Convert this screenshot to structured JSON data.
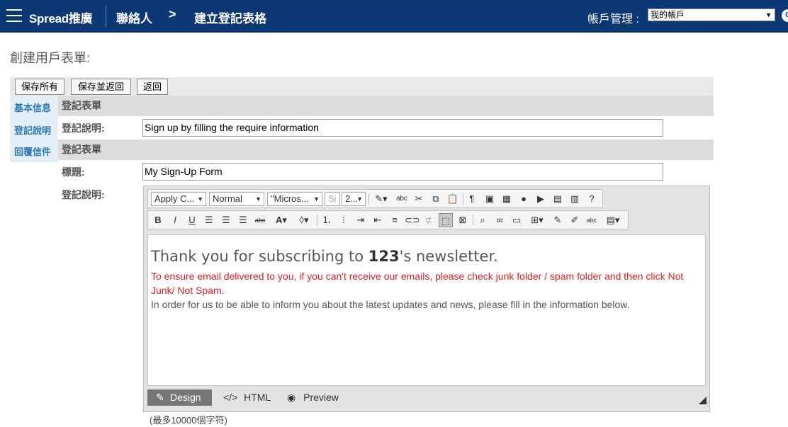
{
  "topbar": {
    "brand": "Spread推廣",
    "crumb1": "聯絡人",
    "chevron": ">",
    "crumb2": "建立登記表格",
    "account_label": "帳戶管理 :",
    "account_value": "我的帳戶",
    "bg_color": "#0d3876"
  },
  "page": {
    "heading": "創建用戶表單:"
  },
  "buttons": {
    "save_all": "保存所有",
    "save_return": "保存並返回",
    "back": "返回"
  },
  "nav": {
    "items": [
      "基本信息",
      "登記說明",
      "回覆信件"
    ]
  },
  "section1": {
    "title": "登記表單",
    "desc_label": "登記說明:",
    "desc_value": "Sign up by filling the require information"
  },
  "section2": {
    "title": "登記表單",
    "title_label": "標題:",
    "title_value": "My Sign-Up Form",
    "desc_label": "登記說明:"
  },
  "editor": {
    "dropdowns": {
      "css_class": "Apply C...",
      "format": "Normal",
      "font": "\"Micros...",
      "size_prefix": "Si",
      "size": "2..."
    },
    "content": {
      "heading_pre": "Thank you for subscribing to ",
      "heading_bold": "123",
      "heading_post": "'s newsletter.",
      "red_text": "To ensure email delivered to you, if you can't receive our emails, please check junk folder / spam folder and then click Not Junk/ Not Spam.",
      "gray_text": "In order for us to be able to inform you about the latest updates and news, please fill in the information below."
    },
    "modes": {
      "design": "Design",
      "html": "HTML",
      "preview": "Preview"
    },
    "char_limit_note": "(最多10000個字符)"
  }
}
